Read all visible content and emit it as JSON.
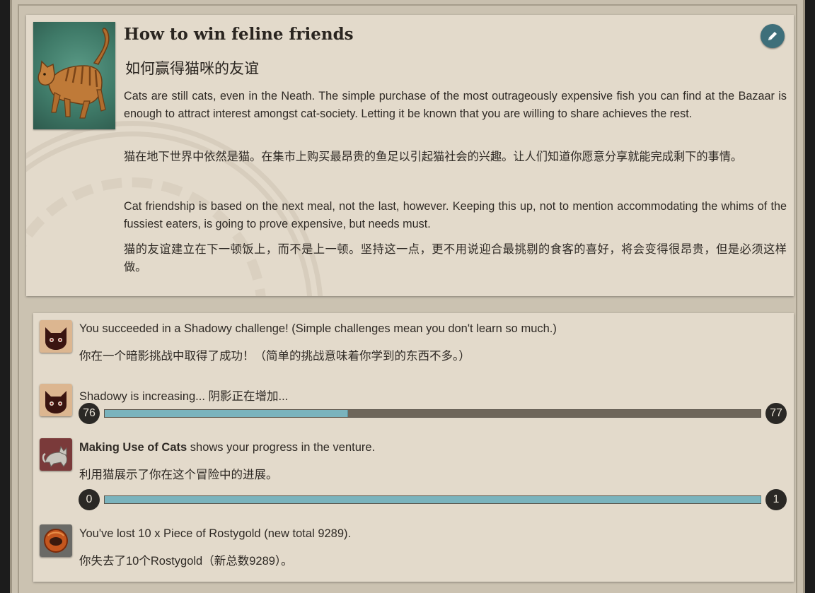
{
  "story": {
    "title": "How to win feline friends",
    "subtitle": "如何赢得猫咪的友谊",
    "image_icon": "cat-illustration",
    "edit_icon": "pencil-icon",
    "paragraphs": [
      "Cats are still cats, even in the Neath. The simple purchase of the most outrageously expensive fish you can find at the Bazaar is enough to attract interest amongst cat-society. Letting it be known that you are willing to share achieves the rest.",
      "猫在地下世界中依然是猫。在集市上购买最昂贵的鱼足以引起猫社会的兴趣。让人们知道你愿意分享就能完成剩下的事情。",
      "Cat friendship is based on the next meal, not the last, however. Keeping this up, not to mention accommodating the whims of the fussiest eaters, is going to prove expensive, but needs must.",
      "猫的友谊建立在下一顿饭上，而不是上一顿。坚持这一点，更不用说迎合最挑剔的食客的喜好，将会变得很昂贵，但是必须这样做。"
    ]
  },
  "results": [
    {
      "icon": "shadowy-cat-mask-icon",
      "text": "You succeeded in a Shadowy challenge! (Simple challenges mean you don't learn so much.)",
      "text_cn": "你在一个暗影挑战中取得了成功！（简单的挑战意味着你学到的东西不多。）"
    },
    {
      "icon": "shadowy-cat-mask-icon",
      "text": "Shadowy is increasing... 阴影正在增加...",
      "progress": {
        "start": "76",
        "end": "77",
        "fraction": 0.37
      }
    },
    {
      "icon": "grey-cat-icon",
      "text_bold": "Making Use of Cats",
      "text_rest": " shows your progress in the venture.",
      "text_cn": "利用猫展示了你在这个冒险中的进展。",
      "progress": {
        "start": "0",
        "end": "1",
        "fraction": 1.0
      }
    },
    {
      "icon": "rostygold-ring-icon",
      "text": "You've lost 10 x Piece of Rostygold (new total 9289).",
      "text_cn": "你失去了10个Rostygold（新总数9289）。"
    }
  ],
  "colors": {
    "card_bg": "#e3dacb",
    "page_bg": "#c8bfae",
    "progress_fill": "#7ab3bd",
    "progress_track": "#6e665a",
    "edit_button": "#3e6f7a"
  }
}
